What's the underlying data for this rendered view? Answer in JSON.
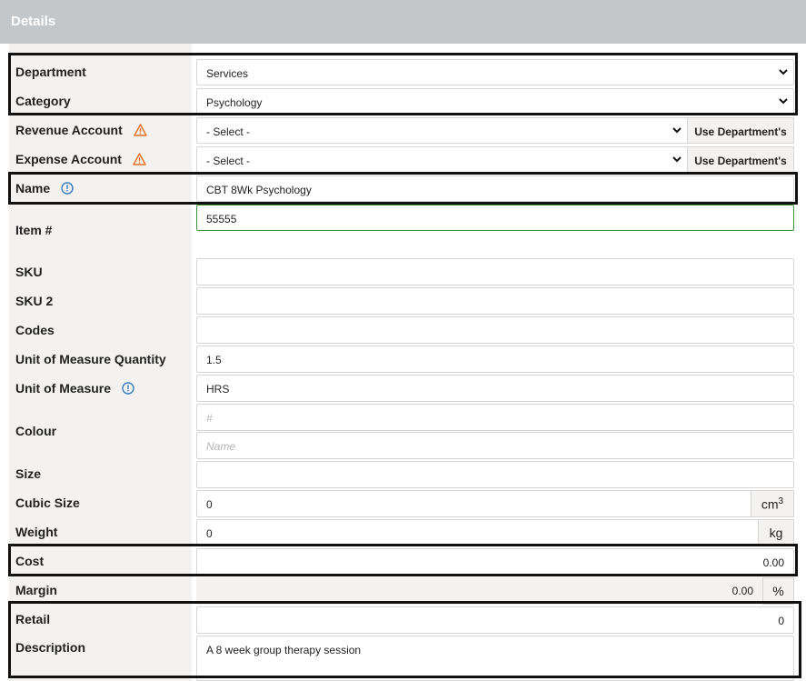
{
  "header": {
    "title": "Details"
  },
  "department": {
    "label": "Department",
    "value": "Services"
  },
  "category": {
    "label": "Category",
    "value": "Psychology"
  },
  "revenue_account": {
    "label": "Revenue Account",
    "value": "- Select -",
    "button": "Use Department's"
  },
  "expense_account": {
    "label": "Expense Account",
    "value": "- Select -",
    "button": "Use Department's"
  },
  "name": {
    "label": "Name",
    "value": "CBT 8Wk Psychology"
  },
  "item_number": {
    "label": "Item #",
    "value": "55555"
  },
  "sku": {
    "label": "SKU",
    "value": ""
  },
  "sku2": {
    "label": "SKU 2",
    "value": ""
  },
  "codes": {
    "label": "Codes",
    "value": ""
  },
  "uom_quantity": {
    "label": "Unit of Measure Quantity",
    "value": "1.5"
  },
  "uom": {
    "label": "Unit of Measure",
    "value": "HRS"
  },
  "colour": {
    "label": "Colour",
    "hex_placeholder": "#",
    "name_placeholder": "Name"
  },
  "size": {
    "label": "Size",
    "value": ""
  },
  "cubic_size": {
    "label": "Cubic Size",
    "value": "0",
    "unit": "cm",
    "unit_sup": "3"
  },
  "weight": {
    "label": "Weight",
    "value": "0",
    "unit": "kg"
  },
  "cost": {
    "label": "Cost",
    "value": "0.00"
  },
  "margin": {
    "label": "Margin",
    "value": "0.00",
    "unit": "%"
  },
  "retail": {
    "label": "Retail",
    "value": "0"
  },
  "description": {
    "label": "Description",
    "value": "A 8 week group therapy session"
  },
  "colors": {
    "warning": "#e8732a",
    "info": "#3b7bbf",
    "valid_border": "#3a9a3a",
    "highlight": "#111111"
  }
}
